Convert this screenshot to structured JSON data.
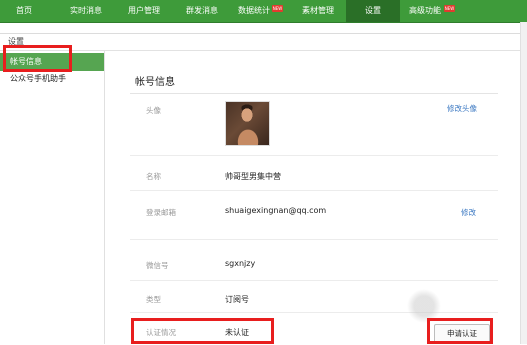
{
  "nav": {
    "items": [
      {
        "label": "首页",
        "new": false,
        "active": false
      },
      {
        "label": "实时消息",
        "new": false,
        "active": false
      },
      {
        "label": "用户管理",
        "new": false,
        "active": false
      },
      {
        "label": "群发消息",
        "new": false,
        "active": false
      },
      {
        "label": "数据统计",
        "new": true,
        "active": false
      },
      {
        "label": "素材管理",
        "new": false,
        "active": false
      },
      {
        "label": "设置",
        "new": false,
        "active": true
      },
      {
        "label": "高级功能",
        "new": true,
        "active": false
      }
    ],
    "new_badge": "NEW"
  },
  "breadcrumb": "设置",
  "sidebar": {
    "items": [
      {
        "label": "帐号信息",
        "active": true
      },
      {
        "label": "公众号手机助手",
        "active": false
      }
    ]
  },
  "account": {
    "section_title": "帐号信息",
    "avatar_label": "头像",
    "avatar_action": "修改头像",
    "name_label": "名称",
    "name_value": "帅哥型男集中营",
    "email_label": "登录邮箱",
    "email_value": "shuaigexingnan@qq.com",
    "email_action": "修改",
    "wechat_label": "微信号",
    "wechat_value": "sgxnjzy",
    "type_label": "类型",
    "type_value": "订阅号",
    "verify_label": "认证情况",
    "verify_value": "未认证",
    "verify_action": "申请认证"
  },
  "colors": {
    "nav_green": "#3e9b3a",
    "sidebar_active": "#56a551",
    "highlight_red": "#e81e1e",
    "link_blue": "#3b78c2"
  }
}
